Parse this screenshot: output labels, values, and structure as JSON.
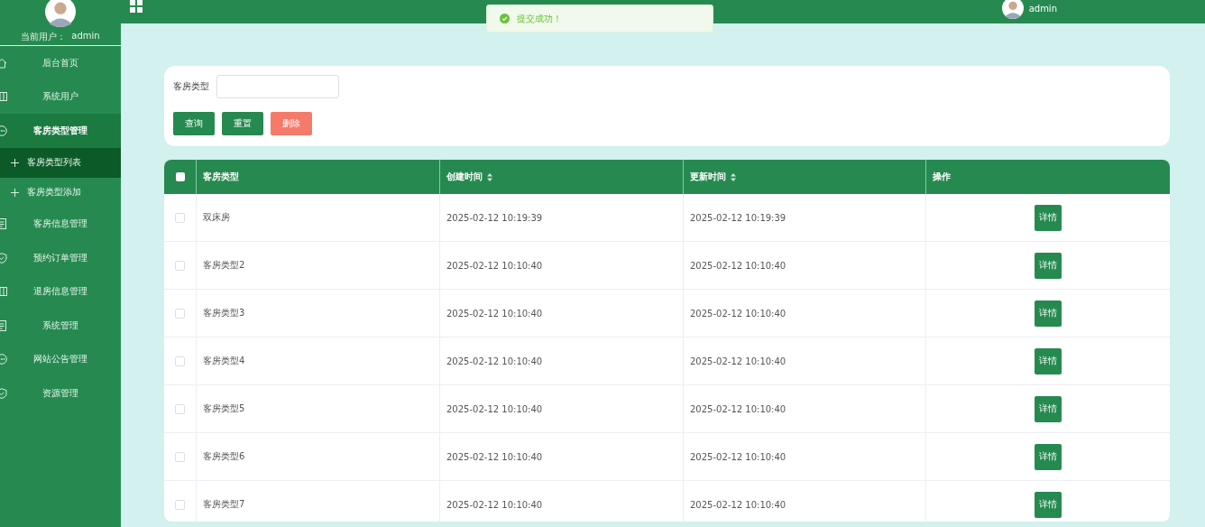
{
  "sidebar": {
    "current_user_label": "当前用户：",
    "current_user": "admin",
    "menu": [
      {
        "label": "后台首页",
        "expanded": false
      },
      {
        "label": "系统用户",
        "expanded": false
      },
      {
        "label": "客房类型管理",
        "expanded": true,
        "children": [
          {
            "label": "客房类型列表",
            "selected": true
          },
          {
            "label": "客房类型添加",
            "selected": false
          }
        ]
      },
      {
        "label": "客房信息管理",
        "expanded": false
      },
      {
        "label": "预约订单管理",
        "expanded": false
      },
      {
        "label": "退房信息管理",
        "expanded": false
      },
      {
        "label": "系统管理",
        "expanded": false
      },
      {
        "label": "网站公告管理",
        "expanded": false
      },
      {
        "label": "资源管理",
        "expanded": false
      }
    ]
  },
  "header": {
    "user": "admin"
  },
  "toast": {
    "text": "提交成功！"
  },
  "search": {
    "label": "客房类型",
    "buttons": [
      {
        "label": "查询",
        "kind": "primary"
      },
      {
        "label": "重置",
        "kind": "primary"
      },
      {
        "label": "删除",
        "kind": "danger"
      }
    ]
  },
  "table": {
    "all_checked": false,
    "columns": [
      {
        "label": "客房类型",
        "sortable": false
      },
      {
        "label": "创建时间",
        "sortable": true
      },
      {
        "label": "更新时间",
        "sortable": true
      },
      {
        "label": "操作",
        "sortable": false
      }
    ],
    "rows": [
      {
        "checked": false,
        "type": "双床房",
        "created": "2025-02-12 10:19:39",
        "updated": "2025-02-12 10:19:39",
        "action": "详情"
      },
      {
        "checked": false,
        "type": "客房类型2",
        "created": "2025-02-12 10:10:40",
        "updated": "2025-02-12 10:10:40",
        "action": "详情"
      },
      {
        "checked": false,
        "type": "客房类型3",
        "created": "2025-02-12 10:10:40",
        "updated": "2025-02-12 10:10:40",
        "action": "详情"
      },
      {
        "checked": false,
        "type": "客房类型4",
        "created": "2025-02-12 10:10:40",
        "updated": "2025-02-12 10:10:40",
        "action": "详情"
      },
      {
        "checked": false,
        "type": "客房类型5",
        "created": "2025-02-12 10:10:40",
        "updated": "2025-02-12 10:10:40",
        "action": "详情"
      },
      {
        "checked": false,
        "type": "客房类型6",
        "created": "2025-02-12 10:10:40",
        "updated": "2025-02-12 10:10:40",
        "action": "详情"
      },
      {
        "checked": false,
        "type": "客房类型7",
        "created": "2025-02-12 10:10:40",
        "updated": "2025-02-12 10:10:40",
        "action": "详情"
      }
    ]
  }
}
